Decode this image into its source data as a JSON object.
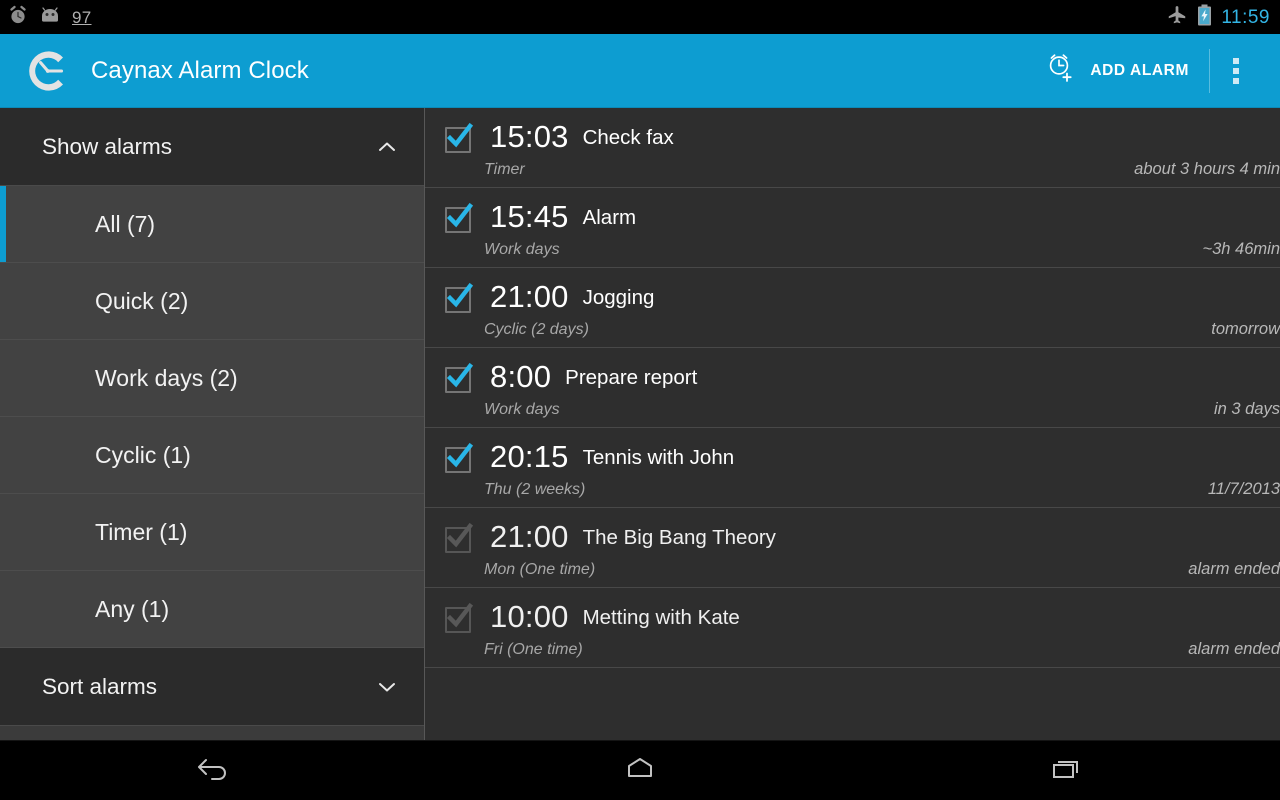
{
  "statusbar": {
    "battery_percent": "97",
    "clock": "11:59",
    "icons": [
      "alarm-clock-icon",
      "android-robot-icon",
      "airplane-mode-icon",
      "battery-charging-icon"
    ]
  },
  "actionbar": {
    "app_title": "Caynax Alarm Clock",
    "add_alarm_label": "ADD ALARM",
    "accent_color": "#0d9dd1"
  },
  "sidebar": {
    "show_section": {
      "label": "Show alarms",
      "expanded": true
    },
    "sort_section": {
      "label": "Sort alarms",
      "expanded": false
    },
    "filters": [
      {
        "label": "All (7)",
        "selected": true
      },
      {
        "label": "Quick (2)",
        "selected": false
      },
      {
        "label": "Work days (2)",
        "selected": false
      },
      {
        "label": "Cyclic (1)",
        "selected": false
      },
      {
        "label": "Timer (1)",
        "selected": false
      },
      {
        "label": "Any (1)",
        "selected": false
      }
    ]
  },
  "alarms": [
    {
      "time": "15:03",
      "name": "Check fax",
      "schedule": "Timer",
      "when": "about 3 hours 4 min",
      "enabled": true
    },
    {
      "time": "15:45",
      "name": "Alarm",
      "schedule": "Work days",
      "when": "~3h 46min",
      "enabled": true
    },
    {
      "time": "21:00",
      "name": "Jogging",
      "schedule": "Cyclic (2 days)",
      "when": "tomorrow",
      "enabled": true
    },
    {
      "time": "8:00",
      "name": "Prepare report",
      "schedule": "Work days",
      "when": "in 3 days",
      "enabled": true
    },
    {
      "time": "20:15",
      "name": "Tennis with John",
      "schedule": "Thu (2 weeks)",
      "when": "11/7/2013",
      "enabled": true
    },
    {
      "time": "21:00",
      "name": "The Big Bang Theory",
      "schedule": "Mon (One time)",
      "when": "alarm ended",
      "enabled": false
    },
    {
      "time": "10:00",
      "name": "Metting with Kate",
      "schedule": "Fri (One time)",
      "when": "alarm ended",
      "enabled": false
    }
  ],
  "navbar": {
    "back": "back-icon",
    "home": "home-icon",
    "recents": "recents-icon"
  }
}
